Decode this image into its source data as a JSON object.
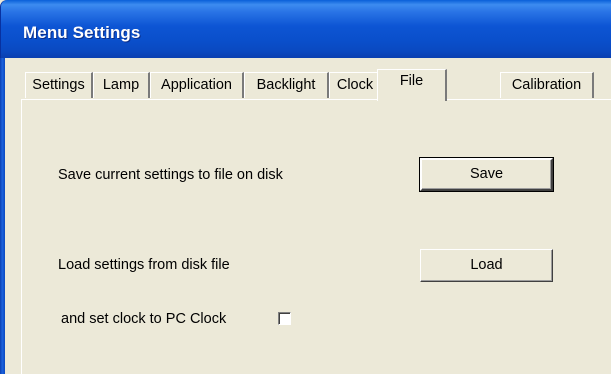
{
  "window": {
    "title": "Menu Settings",
    "title_bar_color": "#0a4fcb",
    "face_color": "#ece9d8"
  },
  "tabs": [
    {
      "label": "Settings",
      "active": false
    },
    {
      "label": "Lamp",
      "active": false
    },
    {
      "label": "Application",
      "active": false
    },
    {
      "label": "Backlight",
      "active": false
    },
    {
      "label": "Clock",
      "active": false
    },
    {
      "label": "File",
      "active": true
    },
    {
      "label": "Calibration",
      "active": false
    }
  ],
  "file_tab": {
    "save_label_text": "Save current settings to file on disk",
    "save_button": "Save",
    "load_label_text": "Load settings from disk file",
    "load_button": "Load",
    "set_clock_label": "and set clock to PC Clock",
    "set_clock_checked": false
  }
}
